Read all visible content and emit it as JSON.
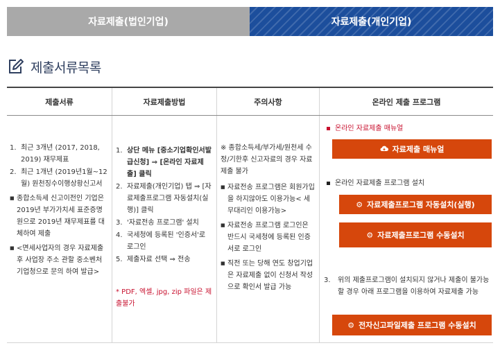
{
  "tabs": [
    {
      "label": "자료제출(법인기업)"
    },
    {
      "label": "자료제출(개인기업)"
    }
  ],
  "section": {
    "title": "제출서류목록"
  },
  "table": {
    "headers": [
      "제출서류",
      "자료제출방법",
      "주의사항",
      "온라인 제출 프로그램"
    ],
    "col1": {
      "items": [
        {
          "num": "1.",
          "text": "최근 3개년 (2017, 2018, 2019) 재무제표"
        },
        {
          "num": "2.",
          "text": "최근 1개년 (2019년1월~12월) 원천징수이행상황신고서"
        }
      ],
      "bullets": [
        {
          "text": "종합소득세 신고이전인 기업은 2019년 부가가치세 표준증명원으로 2019년 재무제표를 대체하여 제출"
        },
        {
          "text": "<면세사업자의 경우 자료제출 후 사업장 주소 관할 중소벤처기업청으로 문의 하여 발급>"
        }
      ]
    },
    "col2": {
      "items": [
        {
          "num": "1.",
          "text": "상단 메뉴 [중소기업확인서발급신청] ⇒ [온라인 자료제출] 클릭"
        },
        {
          "num": "2.",
          "text": "자료제출(개인기업) 탭 ⇒ [자료제출프로그램 자동설치(실행)] 클릭"
        },
        {
          "num": "3.",
          "text": "'자료전송 프로그램' 설치"
        },
        {
          "num": "4.",
          "text": "국세청에 등록된 '인증서'로 로그인"
        },
        {
          "num": "5.",
          "text": "제출자료 선택 ⇒ 전송"
        }
      ],
      "note": "* PDF, 엑셀, jpg, zip 파일은 제출불가"
    },
    "col3": {
      "note": "※ 종합소득세/부가세/원천세 수정/기한후 신고자료의 경우 자료제출 불가",
      "bullets": [
        {
          "text": "자료전송 프로그램은 회원가입을 하지않아도 이용가능< 세무대리인 이용가능>"
        },
        {
          "text": "자료전송 프로그램 로그인은 반드시 국세청에 등록된 인증서로 로그인"
        },
        {
          "text": "직전 또는 당해 연도 창업기업은 자료제출 없이 신청서 작성으로 확인서 발급 가능"
        }
      ]
    },
    "col4": {
      "manual_label": "온라인 자료제출 매뉴얼",
      "manual_button": "자료제출 매뉴얼",
      "install_label": "온라인 자료제출 프로그램 설치",
      "auto_button": "자료제출프로그램 자동설치(실행)",
      "manual_install_button": "자료제출프로그램 수동설치",
      "note_num": "3.",
      "note_text": "위의 제출프로그램이 설치되지 않거나 제출이 불가능할 경우 아래 프로그램을 이용하여 자료제출 가능",
      "efile_button": "전자신고파일제출 프로그램 수동설치"
    }
  },
  "colors": {
    "tab_inactive": "#a9a9a9",
    "tab_active": "#1c4e9c",
    "button": "#d6470c",
    "accent_red": "#c8102e"
  },
  "icons": {
    "title": "edit-icon",
    "manual": "cloud-download-icon",
    "install": "gear-icon"
  }
}
